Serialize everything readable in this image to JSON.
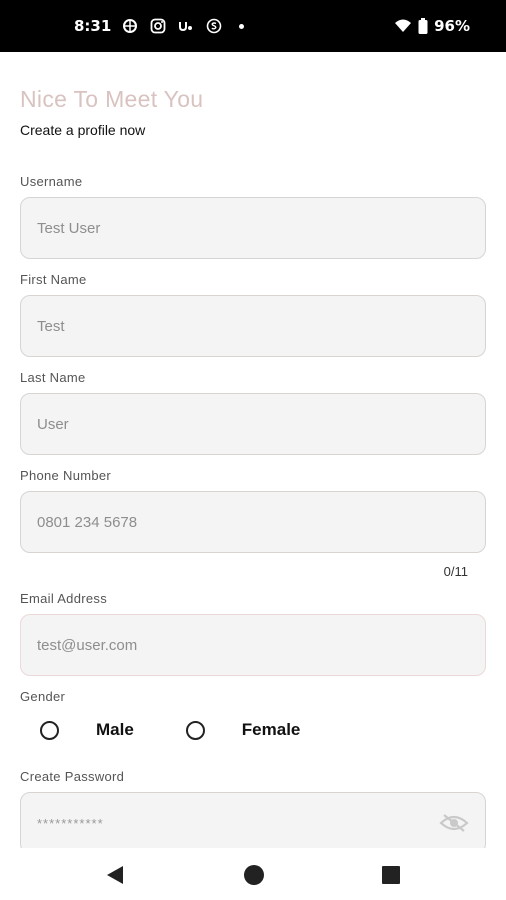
{
  "status_bar": {
    "time": "8:31",
    "battery": "96%",
    "icons": [
      "bug-icon",
      "instagram-icon",
      "upwork-icon",
      "skype-icon",
      "dot-icon",
      "wifi-icon",
      "battery-icon"
    ]
  },
  "header": {
    "title": "Nice To Meet You",
    "subtitle": "Create a profile now",
    "title_color": "#d9c3c1"
  },
  "form": {
    "username": {
      "label": "Username",
      "placeholder": "Test User"
    },
    "first_name": {
      "label": "First Name",
      "placeholder": "Test"
    },
    "last_name": {
      "label": "Last Name",
      "placeholder": "User"
    },
    "phone": {
      "label": "Phone Number",
      "placeholder": "0801 234 5678",
      "counter": "0/11"
    },
    "email": {
      "label": "Email Address",
      "placeholder": "test@user.com"
    },
    "gender": {
      "label": "Gender",
      "options": [
        "Male",
        "Female"
      ]
    },
    "password": {
      "label": "Create Password",
      "placeholder": "***********",
      "toggle_icon": "eye-off-icon"
    }
  },
  "nav_bar": {
    "icons": [
      "back-icon",
      "home-icon",
      "recents-icon"
    ]
  }
}
